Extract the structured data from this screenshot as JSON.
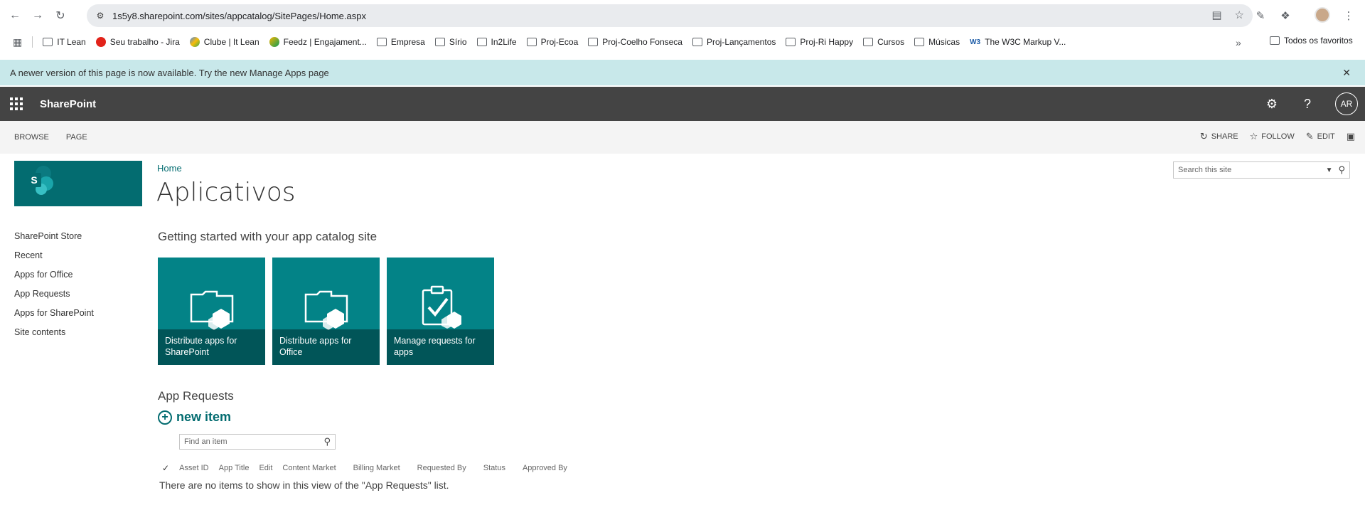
{
  "browser": {
    "url": "1s5y8.sharepoint.com/sites/appcatalog/SitePages/Home.aspx",
    "bookmarks": [
      {
        "label": "IT Lean",
        "icon": "folder-icon"
      },
      {
        "label": "Seu trabalho - Jira",
        "icon": "jira-icon"
      },
      {
        "label": "Clube | It Lean",
        "icon": "clube-icon"
      },
      {
        "label": "Feedz | Engajament...",
        "icon": "feedz-icon"
      },
      {
        "label": "Empresa",
        "icon": "folder-icon"
      },
      {
        "label": "Sírio",
        "icon": "folder-icon"
      },
      {
        "label": "In2Life",
        "icon": "folder-icon"
      },
      {
        "label": "Proj-Ecoa",
        "icon": "folder-icon"
      },
      {
        "label": "Proj-Coelho Fonseca",
        "icon": "folder-icon"
      },
      {
        "label": "Proj-Lançamentos",
        "icon": "folder-icon"
      },
      {
        "label": "Proj-Ri Happy",
        "icon": "folder-icon"
      },
      {
        "label": "Cursos",
        "icon": "folder-icon"
      },
      {
        "label": "Músicas",
        "icon": "folder-icon"
      },
      {
        "label": "The W3C Markup V...",
        "icon": "w3c-icon"
      }
    ],
    "all_bookmarks": "Todos os favoritos"
  },
  "notice": {
    "message": "A newer version of this page is now available. Try the new Manage Apps page"
  },
  "suitebar": {
    "brand": "SharePoint",
    "avatar_initials": "AR"
  },
  "ribbon": {
    "tabs": [
      "BROWSE",
      "PAGE"
    ],
    "actions": {
      "share": "SHARE",
      "follow": "FOLLOW",
      "edit": "EDIT"
    }
  },
  "page": {
    "breadcrumb": "Home",
    "title": "Aplicativos",
    "search_placeholder": "Search this site",
    "getting_started": "Getting started with your app catalog site"
  },
  "leftnav": [
    "SharePoint Store",
    "Recent",
    "Apps for Office",
    "App Requests",
    "Apps for SharePoint",
    "Site contents"
  ],
  "tiles": [
    {
      "caption": "Distribute apps for SharePoint",
      "icon": "folder-app-icon"
    },
    {
      "caption": "Distribute apps for Office",
      "icon": "folder-app-icon"
    },
    {
      "caption": "Manage requests for apps",
      "icon": "clipboard-check-icon"
    }
  ],
  "app_requests": {
    "title": "App Requests",
    "new_item": "new item",
    "find_placeholder": "Find an item",
    "columns": [
      "Asset ID",
      "App Title",
      "Edit",
      "Content Market",
      "Billing Market",
      "Requested By",
      "Status",
      "Approved By"
    ],
    "empty_message": "There are no items to show in this view of the \"App Requests\" list."
  },
  "colors": {
    "accent": "#036c70",
    "tile": "#038387",
    "suitebar": "#444444",
    "notice": "#c8e8ea"
  }
}
